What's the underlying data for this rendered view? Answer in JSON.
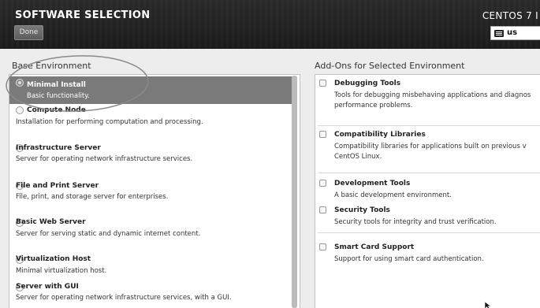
{
  "header": {
    "title": "SOFTWARE SELECTION",
    "done_label": "Done",
    "product": "CENTOS 7 I",
    "keyboard_layout": "us"
  },
  "base_environment": {
    "label": "Base Environment",
    "items": [
      {
        "name": "Minimal Install",
        "desc": "Basic functionality.",
        "selected": true
      },
      {
        "name": "Compute Node",
        "desc": "Installation for performing computation and processing."
      },
      {
        "name": "Infrastructure Server",
        "desc": "Server for operating network infrastructure services."
      },
      {
        "name": "File and Print Server",
        "desc": "File, print, and storage server for enterprises."
      },
      {
        "name": "Basic Web Server",
        "desc": "Server for serving static and dynamic internet content."
      },
      {
        "name": "Virtualization Host",
        "desc": "Minimal virtualization host."
      },
      {
        "name": "Server with GUI",
        "desc": "Server for operating network infrastructure services, with a GUI."
      }
    ]
  },
  "addons": {
    "label": "Add-Ons for Selected Environment",
    "items": [
      {
        "name": "Debugging Tools",
        "desc1": "Tools for debugging misbehaving applications and diagnos",
        "desc2": "performance problems."
      },
      {
        "name": "Compatibility Libraries",
        "desc1": "Compatibility libraries for applications built on previous v",
        "desc2": "CentOS Linux."
      },
      {
        "name": "Development Tools",
        "desc1": "A basic development environment.",
        "desc2": ""
      },
      {
        "name": "Security Tools",
        "desc1": "Security tools for integrity and trust verification.",
        "desc2": ""
      },
      {
        "name": "Smart Card Support",
        "desc1": "Support for using smart card authentication.",
        "desc2": ""
      }
    ]
  },
  "colors": {
    "header_bg": "#1e1e1e",
    "selected_row": "#7a7a7a",
    "annotation_ellipse": "#8a8a8a"
  }
}
